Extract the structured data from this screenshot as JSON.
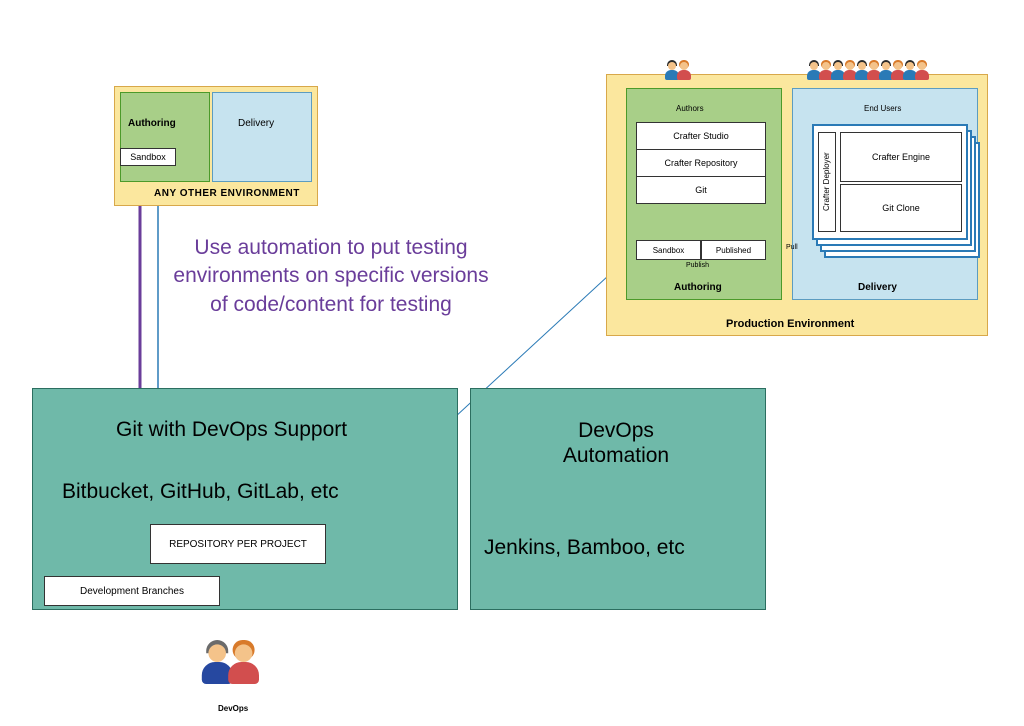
{
  "any_env": {
    "authoring": "Authoring",
    "delivery": "Delivery",
    "sandbox": "Sandbox",
    "footer": "ANY OTHER ENVIRONMENT"
  },
  "annotation": "Use automation to put testing environments on specific versions of code/content for testing",
  "git": {
    "title": "Git with DevOps Support",
    "subtitle": "Bitbucket, GitHub, GitLab, etc",
    "repo_box": "REPOSITORY PER PROJECT",
    "dev_branches": "Development Branches"
  },
  "devops_auto": {
    "title": "DevOps Automation",
    "subtitle": "Jenkins, Bamboo, etc"
  },
  "prod": {
    "authoring": "Authoring",
    "delivery": "Delivery",
    "footer": "Production Environment",
    "stack": {
      "studio": "Crafter Studio",
      "repository": "Crafter Repository",
      "git": "Git"
    },
    "sandbox": "Sandbox",
    "published": "Published",
    "publish_arrow": "Publish",
    "pull_arrow": "Pull",
    "deliv_pane": {
      "deployer": "Crafter Deployer",
      "engine": "Crafter Engine",
      "clone": "Git Clone"
    },
    "authors_label": "Authors",
    "endusers_label": "End Users"
  },
  "devops_people_label": "DevOps"
}
